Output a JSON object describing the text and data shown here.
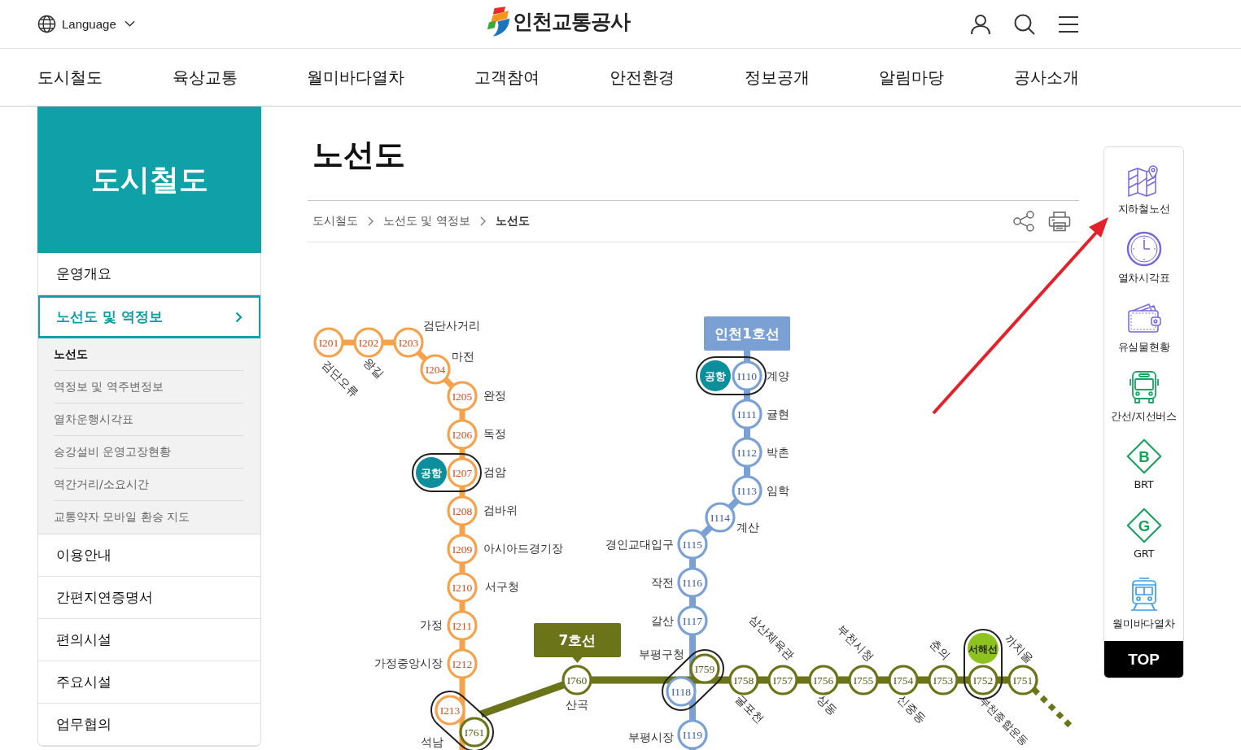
{
  "header": {
    "language": "Language",
    "logo": "인천교통공사"
  },
  "nav": [
    "도시철도",
    "육상교통",
    "월미바다열차",
    "고객참여",
    "안전환경",
    "정보공개",
    "알림마당",
    "공사소개"
  ],
  "sidebar": {
    "title": "도시철도",
    "items": [
      {
        "label": "운영개요",
        "selected": false
      },
      {
        "label": "노선도 및 역정보",
        "selected": true,
        "children": [
          {
            "label": "노선도",
            "selected": true
          },
          {
            "label": "역정보 및 역주변정보",
            "selected": false
          },
          {
            "label": "열차운행시각표",
            "selected": false
          },
          {
            "label": "승강설비 운영고장현황",
            "selected": false
          },
          {
            "label": "역간거리/소요시간",
            "selected": false
          },
          {
            "label": "교통약자 모바일 환승 지도",
            "selected": false
          }
        ]
      },
      {
        "label": "이용안내",
        "selected": false
      },
      {
        "label": "간편지연증명서",
        "selected": false
      },
      {
        "label": "편의시설",
        "selected": false
      },
      {
        "label": "주요시설",
        "selected": false
      },
      {
        "label": "업무협의",
        "selected": false
      }
    ]
  },
  "page": {
    "title": "노선도",
    "breadcrumb": [
      "도시철도",
      "노선도 및 역정보",
      "노선도"
    ]
  },
  "route_map": {
    "lines": [
      {
        "color": "#f6a24c",
        "stations": [
          {
            "code": "I201",
            "name": "검단오류"
          },
          {
            "code": "I202",
            "name": "왕길"
          },
          {
            "code": "I203",
            "name": "검단사거리"
          },
          {
            "code": "I204",
            "name": "마전"
          },
          {
            "code": "I205",
            "name": "완정"
          },
          {
            "code": "I206",
            "name": "독정"
          },
          {
            "code": "I207",
            "name": "검암",
            "transfer": {
              "label": "공항",
              "color": "#0b8f9c"
            }
          },
          {
            "code": "I208",
            "name": "검바위"
          },
          {
            "code": "I209",
            "name": "아시아드경기장"
          },
          {
            "code": "I210",
            "name": "서구청"
          },
          {
            "code": "I211",
            "name": "가정"
          },
          {
            "code": "I212",
            "name": "가정중앙시장"
          },
          {
            "code": "I213",
            "name": "석남"
          }
        ]
      },
      {
        "name": "인천1호선",
        "color": "#7ba1d4",
        "stations": [
          {
            "code": "I110",
            "name": "계양",
            "transfer": {
              "label": "공항",
              "color": "#0b8f9c"
            }
          },
          {
            "code": "I111",
            "name": "귤현"
          },
          {
            "code": "I112",
            "name": "박촌"
          },
          {
            "code": "I113",
            "name": "임학"
          },
          {
            "code": "I114",
            "name": "계산"
          },
          {
            "code": "I115",
            "name": "경인교대입구"
          },
          {
            "code": "I116",
            "name": "작전"
          },
          {
            "code": "I117",
            "name": "갈산"
          },
          {
            "code": "I118",
            "name": "부평구청"
          },
          {
            "code": "I119",
            "name": "부평시장"
          }
        ]
      },
      {
        "name": "7호선",
        "color": "#6b7418",
        "stations": [
          {
            "code": "I761"
          },
          {
            "code": "I760",
            "name": "산곡"
          },
          {
            "code": "I759"
          },
          {
            "code": "I758",
            "name": "굴포천"
          },
          {
            "code": "I757",
            "name": "삼산체육관"
          },
          {
            "code": "I756",
            "name": "상동"
          },
          {
            "code": "I755",
            "name": "부천시청"
          },
          {
            "code": "I754",
            "name": "신중동"
          },
          {
            "code": "I753",
            "name": "춘의"
          },
          {
            "code": "I752",
            "name": "부천종합운동",
            "transfer": {
              "label": "서해선",
              "color": "#8dc21f"
            }
          },
          {
            "code": "I751",
            "name": "까치울"
          }
        ]
      }
    ]
  },
  "quick_menu": {
    "items": [
      {
        "label": "지하철노선"
      },
      {
        "label": "열차시각표"
      },
      {
        "label": "유실물현황"
      },
      {
        "label": "간선/지선버스"
      },
      {
        "label": "BRT",
        "icon_letter": "B"
      },
      {
        "label": "GRT",
        "icon_letter": "G"
      },
      {
        "label": "월미바다열차"
      }
    ],
    "top": "TOP"
  }
}
